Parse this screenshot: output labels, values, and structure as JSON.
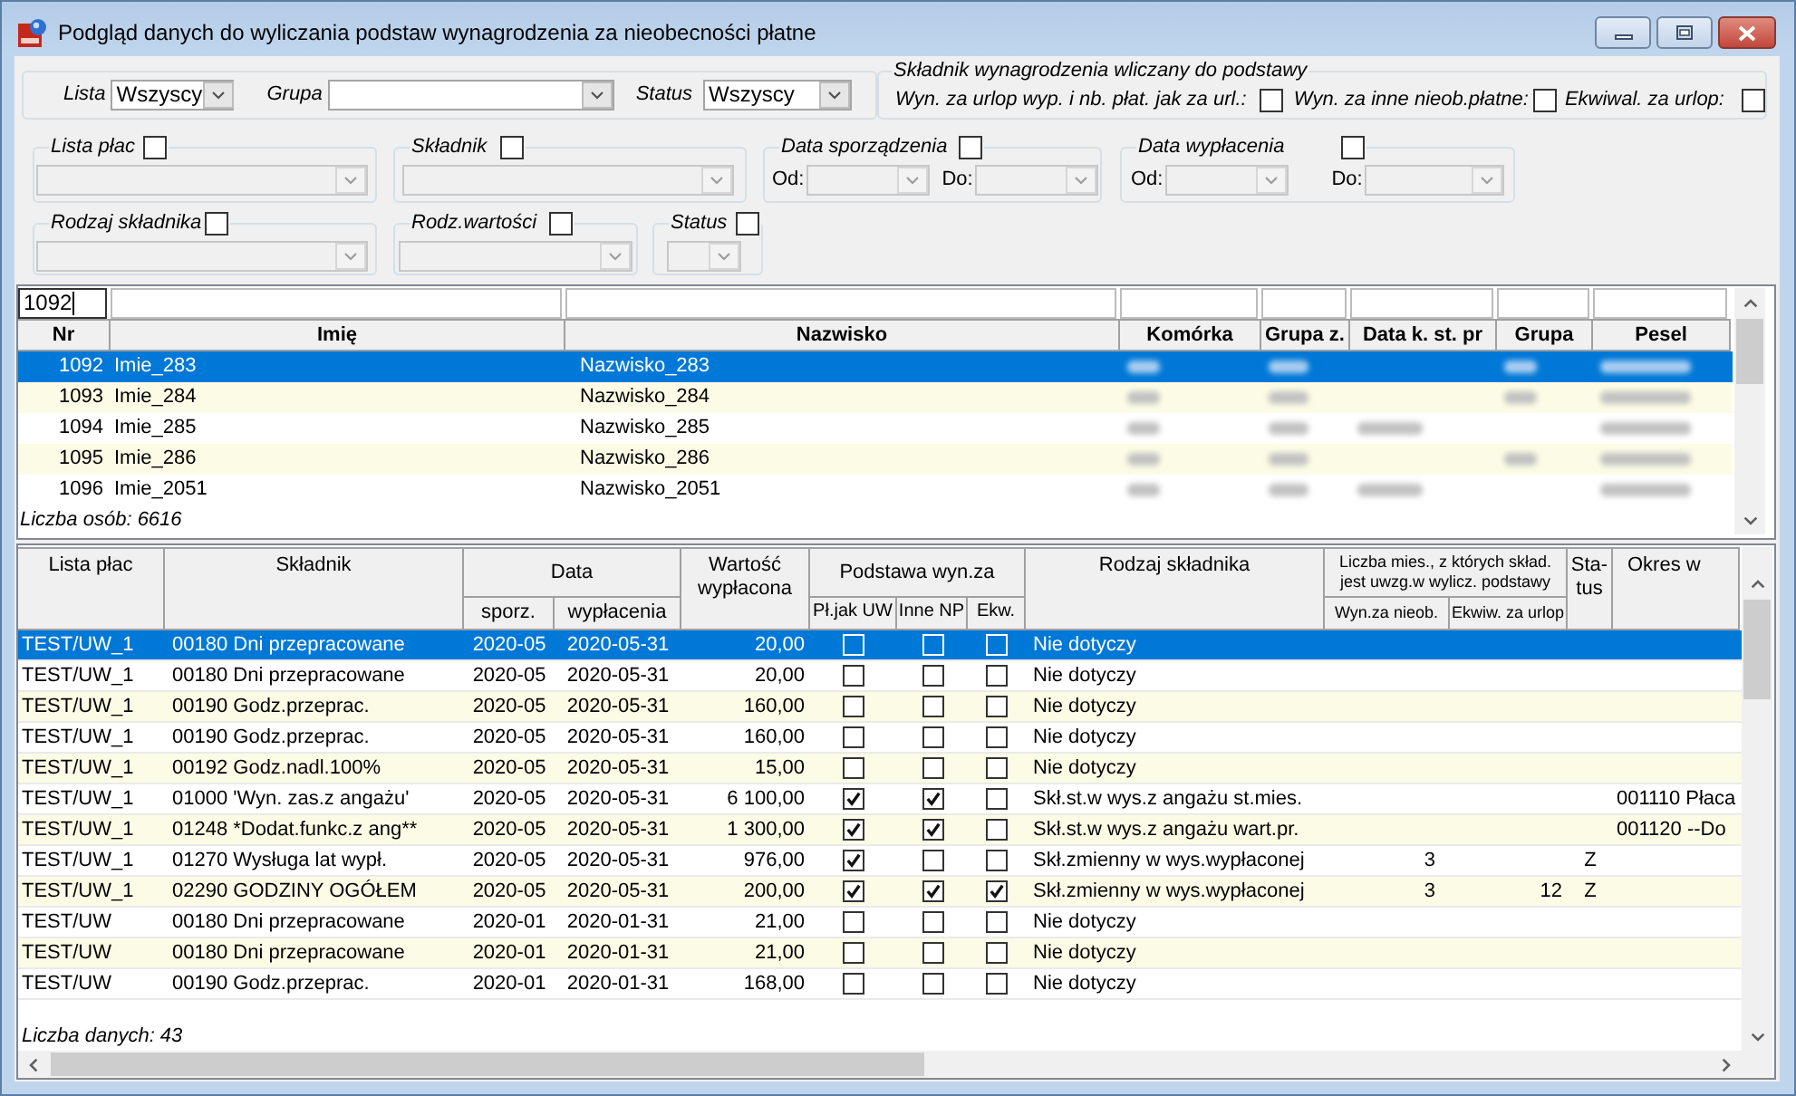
{
  "window": {
    "title": "Podgląd danych do wyliczania podstaw wynagrodzenia za nieobecności płatne"
  },
  "filters": {
    "main": [
      {
        "label": "Lista",
        "value": "Wszyscy"
      },
      {
        "label": "Grupa"
      },
      {
        "label": "Status",
        "value": "Wszyscy"
      }
    ],
    "included": {
      "title": "Składnik wynagrodzenia wliczany do podstawy",
      "options": [
        {
          "label": "Wyn. za urlop wyp. i nb. płat. jak za url.:",
          "checked": false
        },
        {
          "label": "Wyn. za inne nieob.płatne:",
          "checked": false
        },
        {
          "label": "Ekwiwal. za urlop:",
          "checked": false
        }
      ]
    },
    "group_rows": [
      [
        {
          "title": "Lista płac",
          "kind": "single",
          "checked": false
        },
        {
          "title": "Składnik",
          "kind": "single",
          "checked": false
        },
        {
          "title": "Data sporządzenia",
          "kind": "range",
          "checked": false,
          "from_label": "Od:",
          "to_label": "Do:"
        },
        {
          "title": "Data wypłacenia",
          "kind": "range",
          "checked": false,
          "from_label": "Od:",
          "to_label": "Do:"
        }
      ],
      [
        {
          "title": "Rodzaj składnika",
          "kind": "single",
          "checked": false
        },
        {
          "title": "Rodz.wartości",
          "kind": "single",
          "checked": false
        },
        {
          "title": "Status",
          "kind": "single",
          "checked": false
        }
      ]
    ]
  },
  "people": {
    "columns": [
      {
        "label": "Nr",
        "filter": "1092",
        "focused": true
      },
      {
        "label": "Imię",
        "focused": false
      },
      {
        "label": "Nazwisko",
        "focused": false
      },
      {
        "label": "Komórka",
        "focused": false
      },
      {
        "label": "Grupa z.",
        "focused": false
      },
      {
        "label": "Data k. st. pr",
        "focused": false
      },
      {
        "label": "Grupa",
        "focused": false
      },
      {
        "label": "Pesel",
        "focused": false
      }
    ],
    "rows": [
      {
        "nr": "1092",
        "first_name": "Imie_283",
        "last_name": "Nazwisko_283",
        "selected": true,
        "blurred": [
          true,
          true,
          false,
          true,
          true
        ]
      },
      {
        "nr": "1093",
        "first_name": "Imie_284",
        "last_name": "Nazwisko_284",
        "selected": false,
        "blurred": [
          true,
          true,
          false,
          true,
          true
        ]
      },
      {
        "nr": "1094",
        "first_name": "Imie_285",
        "last_name": "Nazwisko_285",
        "selected": false,
        "blurred": [
          true,
          true,
          true,
          false,
          true
        ]
      },
      {
        "nr": "1095",
        "first_name": "Imie_286",
        "last_name": "Nazwisko_286",
        "selected": false,
        "blurred": [
          true,
          true,
          false,
          true,
          true
        ]
      },
      {
        "nr": "1096",
        "first_name": "Imie_2051",
        "last_name": "Nazwisko_2051",
        "selected": false,
        "blurred": [
          true,
          true,
          true,
          false,
          true
        ]
      }
    ],
    "footer": "Liczba osób: 6616"
  },
  "entries": {
    "columns": [
      {
        "label": "Lista płac"
      },
      {
        "label": "Składnik"
      },
      {
        "label": "Data",
        "sub": [
          "sporz.",
          "wypłacenia"
        ]
      },
      {
        "label": "Wartość wypłacona"
      },
      {
        "label": "Podstawa wyn.za",
        "sub": [
          "Pł.jak UW",
          "Inne NP",
          "Ekw."
        ]
      },
      {
        "label": "Rodzaj składnika"
      },
      {
        "label": "Liczba mies., z których skład. jest uwzg.w wylicz. podstawy",
        "sub": [
          "Wyn.za nieob.",
          "Ekwiw. za urlop"
        ]
      },
      {
        "label": "Sta-tus"
      },
      {
        "label": "Okres w"
      }
    ],
    "rows": [
      {
        "list": "TEST/UW_1",
        "component": "00180 Dni przepracowane",
        "prepared": "2020-05",
        "paid": "2020-05-31",
        "value": "20,00",
        "uw": false,
        "other": false,
        "equiv": false,
        "type": "Nie dotyczy",
        "selected": true
      },
      {
        "list": "TEST/UW_1",
        "component": "00180 Dni przepracowane",
        "prepared": "2020-05",
        "paid": "2020-05-31",
        "value": "20,00",
        "uw": false,
        "other": false,
        "equiv": false,
        "type": "Nie dotyczy",
        "selected": false
      },
      {
        "list": "TEST/UW_1",
        "component": "00190 Godz.przeprac.",
        "prepared": "2020-05",
        "paid": "2020-05-31",
        "value": "160,00",
        "uw": false,
        "other": false,
        "equiv": false,
        "type": "Nie dotyczy",
        "selected": false
      },
      {
        "list": "TEST/UW_1",
        "component": "00190 Godz.przeprac.",
        "prepared": "2020-05",
        "paid": "2020-05-31",
        "value": "160,00",
        "uw": false,
        "other": false,
        "equiv": false,
        "type": "Nie dotyczy",
        "selected": false
      },
      {
        "list": "TEST/UW_1",
        "component": "00192 Godz.nadl.100%",
        "prepared": "2020-05",
        "paid": "2020-05-31",
        "value": "15,00",
        "uw": false,
        "other": false,
        "equiv": false,
        "type": "Nie dotyczy",
        "selected": false
      },
      {
        "list": "TEST/UW_1",
        "component": "01000 'Wyn. zas.z angażu'",
        "prepared": "2020-05",
        "paid": "2020-05-31",
        "value": "6 100,00",
        "uw": true,
        "other": true,
        "equiv": false,
        "type": "Skł.st.w wys.z angażu st.mies.",
        "period": "001110 Płaca",
        "selected": false
      },
      {
        "list": "TEST/UW_1",
        "component": "01248 *Dodat.funkc.z ang**",
        "prepared": "2020-05",
        "paid": "2020-05-31",
        "value": "1 300,00",
        "uw": true,
        "other": true,
        "equiv": false,
        "type": "Skł.st.w wys.z angażu wart.pr.",
        "period": "001120 --Do",
        "selected": false
      },
      {
        "list": "TEST/UW_1",
        "component": "01270 Wysługa lat wypł.",
        "prepared": "2020-05",
        "paid": "2020-05-31",
        "value": "976,00",
        "uw": true,
        "other": false,
        "equiv": false,
        "type": "Skł.zmienny w wys.wypłaconej",
        "months_absence": "3",
        "status": "Z",
        "selected": false
      },
      {
        "list": "TEST/UW_1",
        "component": "02290 GODZINY OGÓŁEM",
        "prepared": "2020-05",
        "paid": "2020-05-31",
        "value": "200,00",
        "uw": true,
        "other": true,
        "equiv": true,
        "type": "Skł.zmienny w wys.wypłaconej",
        "months_absence": "3",
        "months_leave": "12",
        "status": "Z",
        "selected": false
      },
      {
        "list": "TEST/UW",
        "component": "00180 Dni przepracowane",
        "prepared": "2020-01",
        "paid": "2020-01-31",
        "value": "21,00",
        "uw": false,
        "other": false,
        "equiv": false,
        "type": "Nie dotyczy",
        "selected": false
      },
      {
        "list": "TEST/UW",
        "component": "00180 Dni przepracowane",
        "prepared": "2020-01",
        "paid": "2020-01-31",
        "value": "21,00",
        "uw": false,
        "other": false,
        "equiv": false,
        "type": "Nie dotyczy",
        "selected": false
      },
      {
        "list": "TEST/UW",
        "component": "00190 Godz.przeprac.",
        "prepared": "2020-01",
        "paid": "2020-01-31",
        "value": "168,00",
        "uw": false,
        "other": false,
        "equiv": false,
        "type": "Nie dotyczy",
        "selected": false
      }
    ],
    "footer": "Liczba danych: 43"
  }
}
